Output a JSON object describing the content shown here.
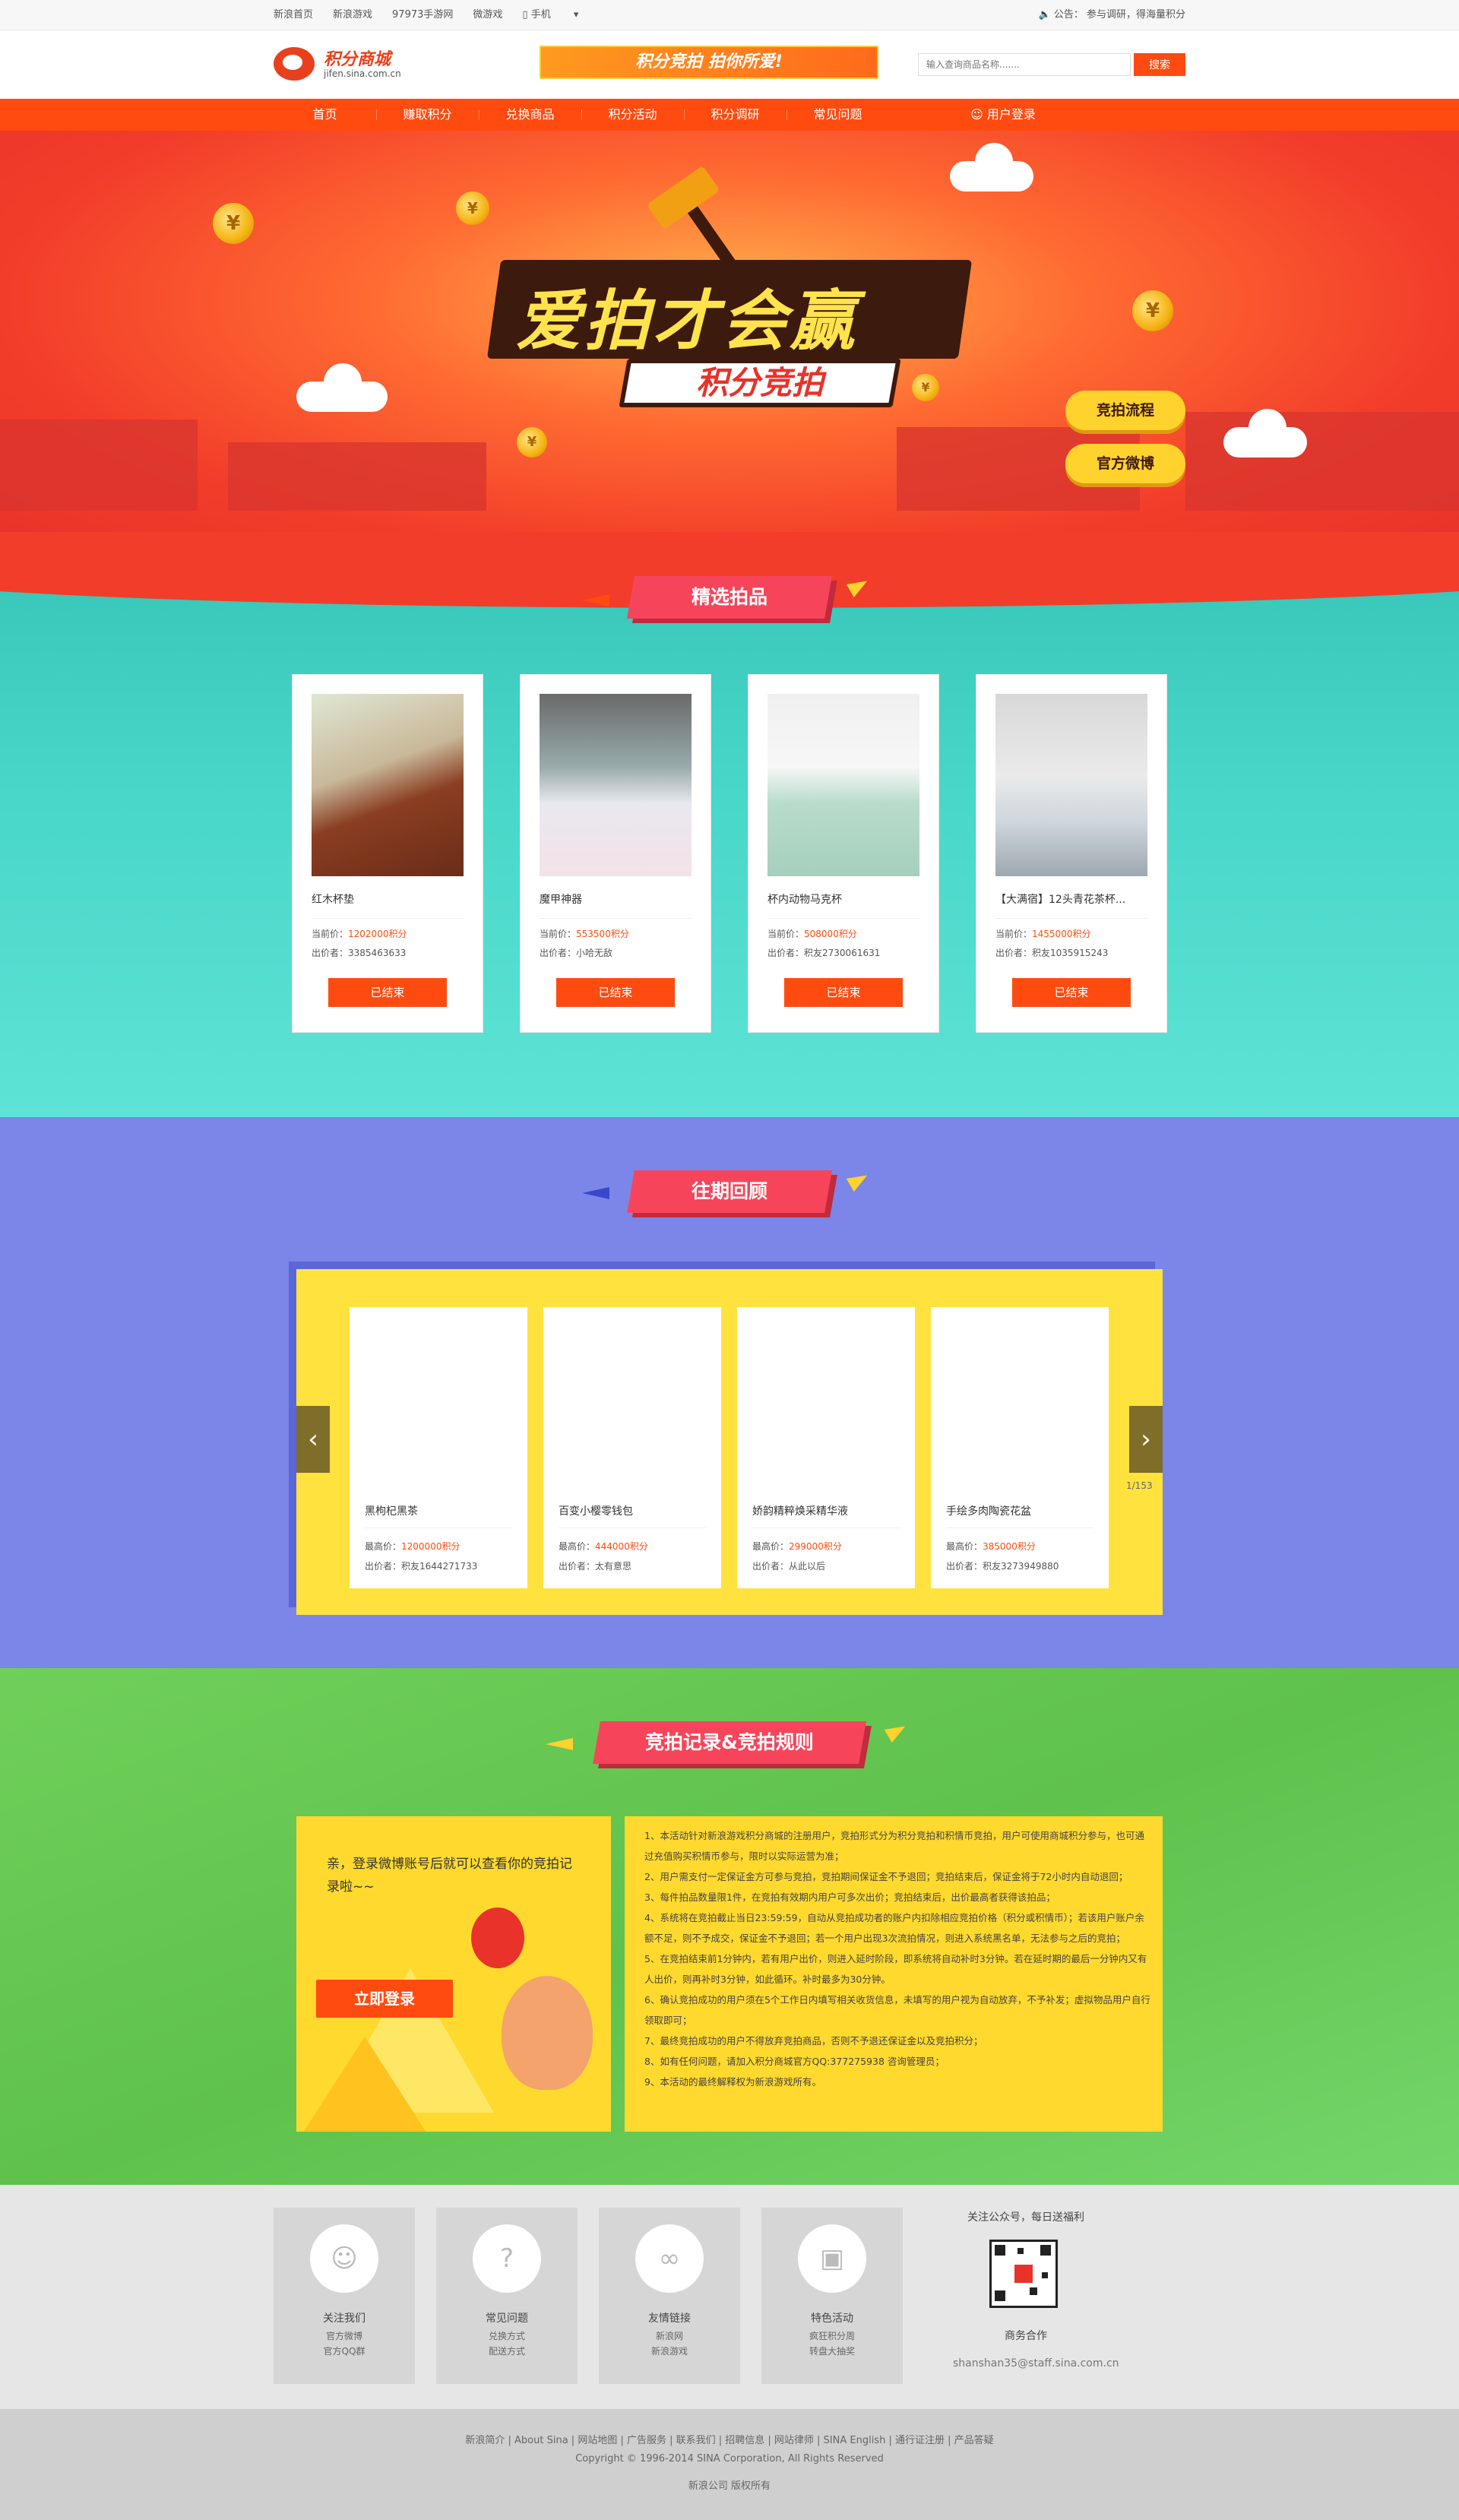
{
  "topbar": {
    "links": [
      "新浪首页",
      "新浪游戏",
      "97973手游网",
      "微游戏",
      "手机"
    ],
    "notice_icon": "speaker-icon",
    "notice": "公告： 参与调研，得海量积分"
  },
  "header": {
    "logo_text": "积分商城",
    "logo_url_text": "jifen.sina.com.cn",
    "ad_text": "积分竞拍 拍你所爱!",
    "search_placeholder": "输入查询商品名称.......",
    "search_button": "搜索"
  },
  "nav": {
    "items": [
      "首页",
      "赚取积分",
      "兑换商品",
      "积分活动",
      "积分调研",
      "常见问题"
    ],
    "login": "用户登录"
  },
  "hero": {
    "title": "爱拍才会赢",
    "subtitle": "积分竞拍",
    "btn_process": "竞拍流程",
    "btn_weibo": "官方微博"
  },
  "featured": {
    "title": "精选拍品",
    "items": [
      {
        "name": "红木杯垫",
        "price_label": "当前价：",
        "price": "1202000积分",
        "bidder_label": "出价者：",
        "bidder": "3385463633",
        "status": "已结束"
      },
      {
        "name": "魔甲神器",
        "price_label": "当前价：",
        "price": "553500积分",
        "bidder_label": "出价者：",
        "bidder": "小哈无敌",
        "status": "已结束"
      },
      {
        "name": "杯内动物马克杯",
        "price_label": "当前价：",
        "price": "508000积分",
        "bidder_label": "出价者：",
        "bidder": "积友2730061631",
        "status": "已结束"
      },
      {
        "name": "【大满宿】12头青花茶杯...",
        "price_label": "当前价：",
        "price": "1455000积分",
        "bidder_label": "出价者：",
        "bidder": "积友1035915243",
        "status": "已结束"
      }
    ]
  },
  "past": {
    "title": "往期回顾",
    "pager": "1/153",
    "items": [
      {
        "name": "黑枸杞黑茶",
        "price_label": "最高价：",
        "price": "1200000积分",
        "bidder_label": "出价者：",
        "bidder": "积友1644271733"
      },
      {
        "name": "百变小樱零钱包",
        "price_label": "最高价：",
        "price": "444000积分",
        "bidder_label": "出价者：",
        "bidder": "太有意思"
      },
      {
        "name": "娇韵精粹焕采精华液",
        "price_label": "最高价：",
        "price": "299000积分",
        "bidder_label": "出价者：",
        "bidder": "从此以后"
      },
      {
        "name": "手绘多肉陶瓷花盆",
        "price_label": "最高价：",
        "price": "385000积分",
        "bidder_label": "出价者：",
        "bidder": "积友3273949880"
      }
    ]
  },
  "records": {
    "title": "竞拍记录&竞拍规则",
    "login_prompt": "亲，登录微博账号后就可以查看你的竞拍记录啦~~",
    "login_button": "立即登录",
    "rules": [
      "1、本活动针对新浪游戏积分商城的注册用户，竞拍形式分为积分竞拍和积情币竞拍，用户可使用商城积分参与，也可通过充值购买积情币参与，限时以实际运营为准；",
      "2、用户需支付一定保证金方可参与竞拍，竞拍期间保证金不予退回；竞拍结束后，保证金将于72小时内自动退回；",
      "3、每件拍品数量限1件，在竞拍有效期内用户可多次出价；竞拍结束后，出价最高者获得该拍品；",
      "4、系统将在竞拍截止当日23:59:59，自动从竞拍成功者的账户内扣除相应竞拍价格（积分或积情币）；若该用户账户余额不足，则不予成交，保证金不予退回；若一个用户出现3次流拍情况，则进入系统黑名单，无法参与之后的竞拍；",
      "5、在竞拍结束前1分钟内，若有用户出价，则进入延时阶段，即系统将自动补时3分钟。若在延时期的最后一分钟内又有人出价，则再补时3分钟，如此循环。补时最多为30分钟。",
      "6、确认竞拍成功的用户须在5个工作日内填写相关收货信息，未填写的用户视为自动放弃，不予补发；虚拟物品用户自行领取即可；",
      "7、最终竞拍成功的用户不得放弃竞拍商品，否则不予退还保证金以及竞拍积分；",
      "8、如有任何问题，请加入积分商城官方QQ:377275938 咨询管理员；",
      "9、本活动的最终解释权为新浪游戏所有。"
    ]
  },
  "footer": {
    "boxes": [
      {
        "icon": "user-plus-icon",
        "title": "关注我们",
        "sub1": "官方微博",
        "sub2": "官方QQ群"
      },
      {
        "icon": "question-icon",
        "title": "常见问题",
        "sub1": "兑换方式",
        "sub2": "配送方式"
      },
      {
        "icon": "link-icon",
        "title": "友情链接",
        "sub1": "新浪网",
        "sub2": "新浪游戏"
      },
      {
        "icon": "gift-icon",
        "title": "特色活动",
        "sub1": "疯狂积分周",
        "sub2": "转盘大抽奖"
      }
    ],
    "qr_title": "关注公众号，每日送福利",
    "business": "商务合作",
    "email": "shanshan35@staff.sina.com.cn"
  },
  "bottom": {
    "links": "新浪简介 | About Sina | 网站地图 | 广告服务 | 联系我们 | 招聘信息 | 网站律师 | SINA English | 通行证注册 | 产品答疑",
    "copyright": "Copyright © 1996-2014 SINA Corporation, All Rights Reserved",
    "company": "新浪公司 版权所有"
  }
}
